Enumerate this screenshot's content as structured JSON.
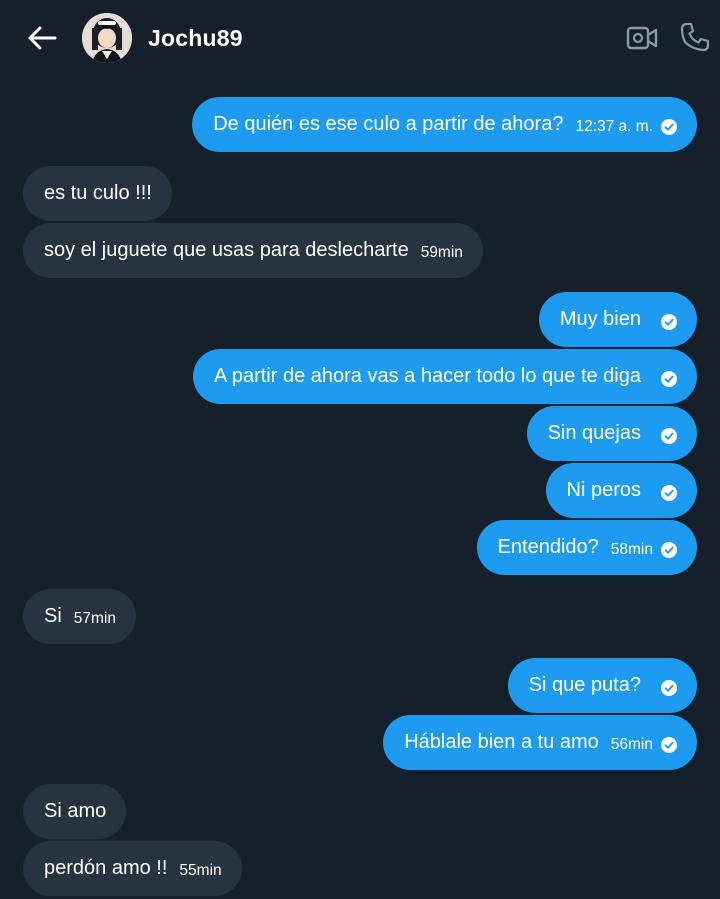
{
  "header": {
    "contact_name": "Jochu89",
    "back_icon": "arrow-left-icon",
    "video_icon": "video-call-icon",
    "call_icon": "phone-icon"
  },
  "colors": {
    "background": "#15202b",
    "outgoing_bubble": "#1d9bf0",
    "incoming_bubble": "#273340"
  },
  "messages": [
    {
      "direction": "out",
      "text": "De quién es ese culo a partir de ahora?",
      "time": "12:37 a. m.",
      "read": true
    },
    {
      "direction": "in",
      "text": "es tu culo !!!",
      "time": ""
    },
    {
      "direction": "in",
      "text": "soy el juguete que usas para deslecharte",
      "time": "59min"
    },
    {
      "direction": "out",
      "text": "Muy bien",
      "time": "",
      "read": true
    },
    {
      "direction": "out",
      "text": "A partir de ahora vas a hacer todo lo que te diga",
      "time": "",
      "read": true
    },
    {
      "direction": "out",
      "text": "Sin quejas",
      "time": "",
      "read": true
    },
    {
      "direction": "out",
      "text": "Ni peros",
      "time": "",
      "read": true
    },
    {
      "direction": "out",
      "text": "Entendido?",
      "time": "58min",
      "read": true
    },
    {
      "direction": "in",
      "text": "Si",
      "time": "57min"
    },
    {
      "direction": "out",
      "text": "Si que puta?",
      "time": "",
      "read": true
    },
    {
      "direction": "out",
      "text": "Háblale bien a tu amo",
      "time": "56min",
      "read": true
    },
    {
      "direction": "in",
      "text": "Si amo",
      "time": ""
    },
    {
      "direction": "in",
      "text": "perdón amo !!",
      "time": "55min"
    }
  ]
}
